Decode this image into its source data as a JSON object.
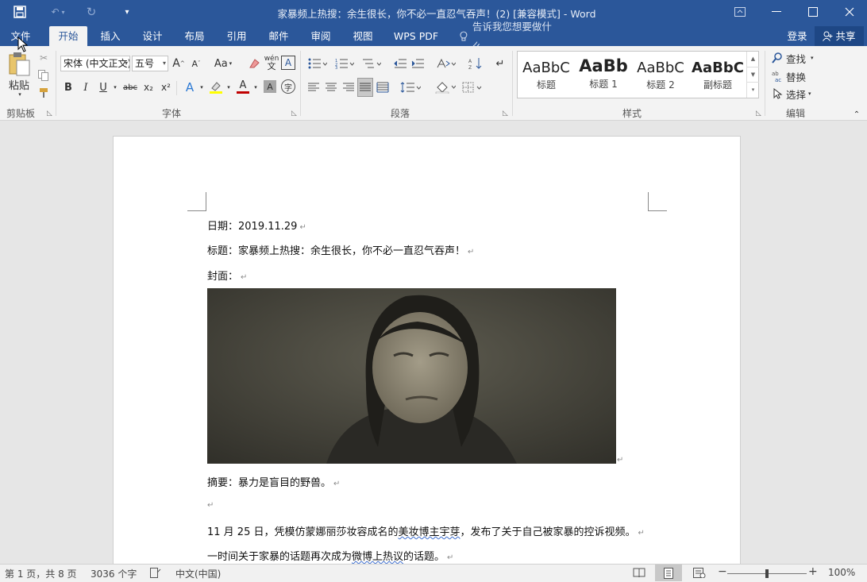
{
  "window": {
    "title": "家暴频上热搜：余生很长，你不必一直忍气吞声！(2) [兼容模式] - Word",
    "login": "登录",
    "share": "共享"
  },
  "tabs": [
    "文件",
    "开始",
    "插入",
    "设计",
    "布局",
    "引用",
    "邮件",
    "审阅",
    "视图",
    "WPS PDF"
  ],
  "tell_me": "告诉我您想要做什么...",
  "ribbon": {
    "clipboard": {
      "paste": "粘贴",
      "group": "剪贴板"
    },
    "font": {
      "name": "宋体 (中文正文)",
      "size": "五号",
      "group": "字体",
      "grow": "A",
      "shrink": "A",
      "case": "Aa",
      "bold": "B",
      "italic": "I",
      "underline": "U",
      "strike": "abc",
      "sub": "x₂",
      "sup": "x²",
      "wen": "wén",
      "char_border": "A",
      "font_color": "A",
      "char_shade": "A",
      "enclose": "字"
    },
    "paragraph": {
      "group": "段落"
    },
    "styles": {
      "group": "样式",
      "items": [
        {
          "preview": "AaBbC",
          "label": "标题"
        },
        {
          "preview": "AaBb",
          "label": "标题 1"
        },
        {
          "preview": "AaBbC",
          "label": "标题 2"
        },
        {
          "preview": "AaBbC",
          "label": "副标题"
        }
      ]
    },
    "editing": {
      "group": "编辑",
      "find": "查找",
      "replace": "替换",
      "select": "选择"
    }
  },
  "document": {
    "date_line": "日期：2019.11.29",
    "title_line": "标题：家暴频上热搜：余生很长，你不必一直忍气吞声！",
    "cover_line": "封面：",
    "abstract_line": "摘要：暴力是盲目的野兽。",
    "body1_pre": "11 月 25 日，凭模仿蒙娜丽莎妆容成名的",
    "body1_wavy": "美妆博主宇芽",
    "body1_post": "，发布了关于自己被家暴的控诉视频。",
    "body2_pre": "一时间关于家暴的话题再次成为",
    "body2_wavy": "微博上热议",
    "body2_post": "的话题。",
    "para_mark": "↵"
  },
  "status": {
    "page": "第 1 页，共 8 页",
    "words": "3036 个字",
    "lang": "中文(中国)",
    "zoom": "100%",
    "zoom_level": 1.0
  },
  "colors": {
    "brand": "#2b579a"
  }
}
